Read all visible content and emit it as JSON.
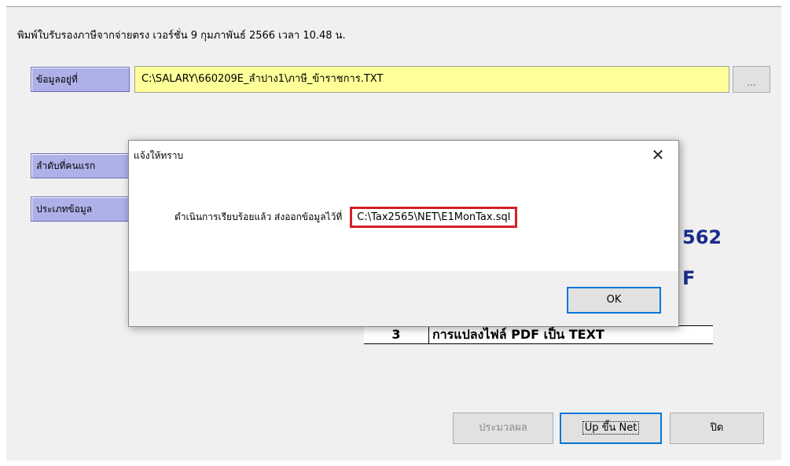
{
  "window": {
    "title": "พิมพ์ใบรับรองภาษีจากจ่ายตรง  เวอร์ชั่น 9 กุมภาพันธ์ 2566 เวลา 10.48 น."
  },
  "form": {
    "file_label": "ข้อมูลอยู่ที่",
    "file_path": "C:\\SALARY\\660209E_ลำปาง1\\ภาษี_ข้าราชการ.TXT",
    "browse_label": "...",
    "first_order_label": "ลำดับที่คนแรก",
    "data_type_label": "ประเภทข้อมูล",
    "partial_year_text": "562",
    "partial_f_text": "F",
    "option_row": {
      "number": "3",
      "text": "การแปลงไฟล์ PDF เป็น TEXT"
    }
  },
  "buttons": {
    "process": "ประมวลผล",
    "upload_net": "Up ขึ้น Net",
    "close": "ปิด"
  },
  "dialog": {
    "title": "แจ้งให้ทราบ",
    "close_glyph": "✕",
    "message": "ดำเนินการเรียบร้อยแล้ว ส่งออกข้อมูลไว้ที่",
    "path": "C:\\Tax2565\\NET\\E1MonTax.sql",
    "ok": "OK"
  },
  "colors": {
    "label_bg": "#aeb0e8",
    "path_field_bg": "#ffff99",
    "highlight_border": "#d4202a",
    "accent_blue": "#1a2d8c",
    "focus_blue": "#0078d7"
  }
}
